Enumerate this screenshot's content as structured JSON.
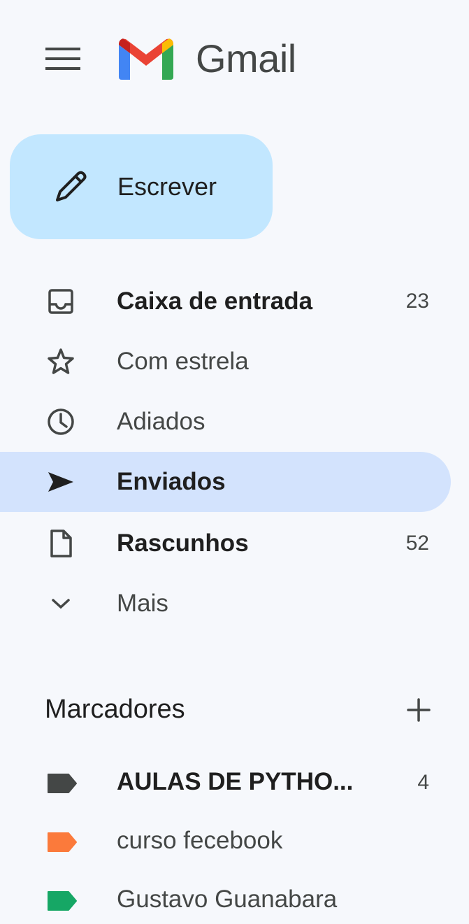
{
  "header": {
    "menu_icon": "hamburger-menu-icon",
    "logo_icon": "gmail-logo",
    "brand_name": "Gmail"
  },
  "compose": {
    "label": "Escrever",
    "icon": "pencil-icon",
    "color": "#c2e7ff"
  },
  "nav": {
    "items": [
      {
        "label": "Caixa de entrada",
        "count": "23",
        "icon": "inbox-icon",
        "bold": true,
        "active": false
      },
      {
        "label": "Com estrela",
        "count": "",
        "icon": "star-icon",
        "bold": false,
        "active": false
      },
      {
        "label": "Adiados",
        "count": "",
        "icon": "clock-icon",
        "bold": false,
        "active": false
      },
      {
        "label": "Enviados",
        "count": "",
        "icon": "send-icon",
        "bold": true,
        "active": true
      },
      {
        "label": "Rascunhos",
        "count": "52",
        "icon": "draft-icon",
        "bold": true,
        "active": false
      },
      {
        "label": "Mais",
        "count": "",
        "icon": "chevron-down-icon",
        "bold": false,
        "active": false
      }
    ],
    "active_color": "#d3e3fd"
  },
  "labels": {
    "title": "Marcadores",
    "add_icon": "plus-icon",
    "items": [
      {
        "label": "AULAS DE PYTHO...",
        "count": "4",
        "color": "#444746",
        "bold": true
      },
      {
        "label": "curso fecebook",
        "count": "",
        "color": "#fb7a3b",
        "bold": false
      },
      {
        "label": "Gustavo Guanabara",
        "count": "",
        "color": "#16a765",
        "bold": false
      }
    ]
  }
}
